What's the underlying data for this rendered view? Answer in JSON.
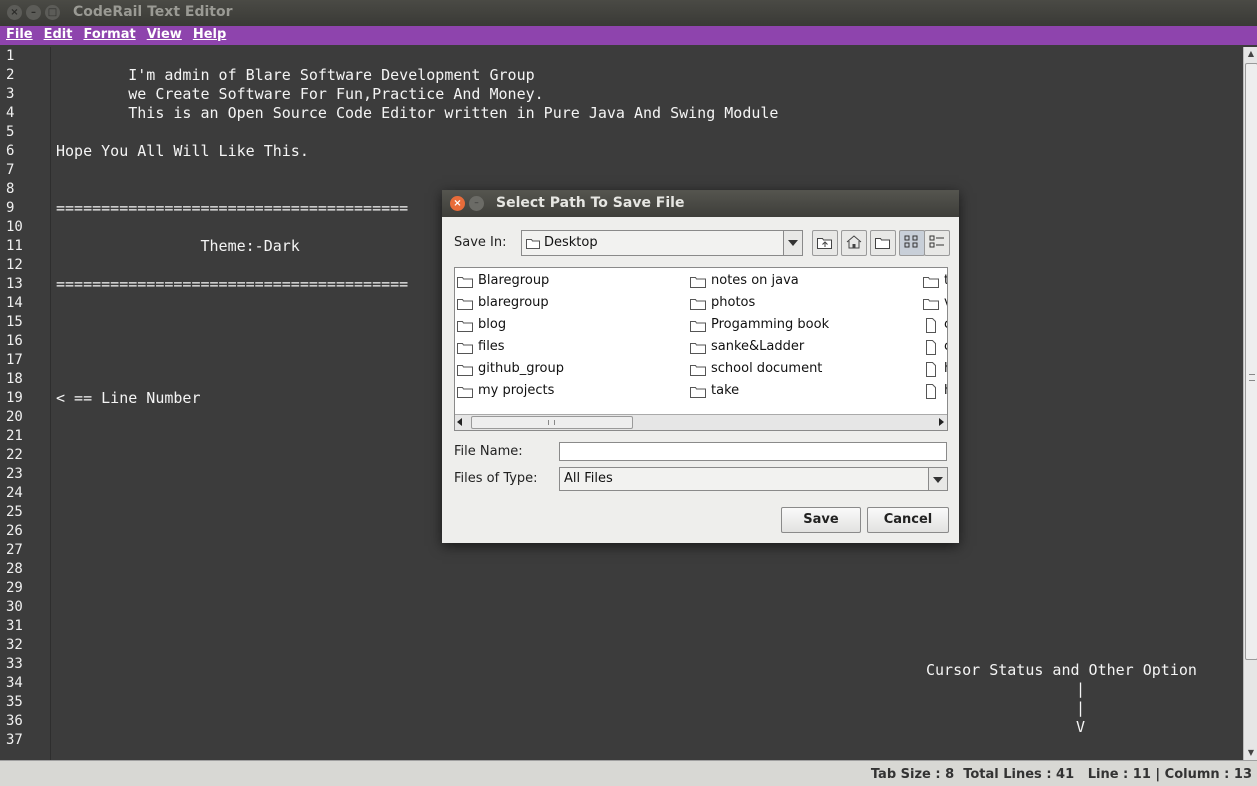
{
  "window": {
    "title": "CodeRail Text Editor"
  },
  "menu": {
    "items": [
      "File",
      "Edit",
      "Format",
      "View",
      "Help"
    ]
  },
  "editor": {
    "line_numbers": [
      "1",
      "2",
      "3",
      "4",
      "5",
      "6",
      "7",
      "8",
      "9",
      "10",
      "11",
      "12",
      "13",
      "14",
      "15",
      "16",
      "17",
      "18",
      "19",
      "20",
      "21",
      "22",
      "23",
      "24",
      "25",
      "26",
      "27",
      "28",
      "29",
      "30",
      "31",
      "32",
      "33",
      "34",
      "35",
      "36",
      "37"
    ],
    "lines": [
      "",
      "        I'm admin of Blare Software Development Group",
      "        we Create Software For Fun,Practice And Money.",
      "        This is an Open Source Code Editor written in Pure Java And Swing Module",
      "",
      "Hope You All Will Like This.",
      "",
      "",
      "=======================================",
      "",
      "                Theme:-Dark",
      "",
      "=======================================",
      "",
      "",
      "",
      "",
      "",
      "< == Line Number"
    ],
    "annotation_lines": [
      "Cursor Status and Other Option",
      "|",
      "|",
      "V"
    ]
  },
  "status": {
    "text": "Tab Size : 8  Total Lines : 41   Line : 11 | Column : 13"
  },
  "dialog": {
    "title": "Select Path To Save File",
    "save_in_label": "Save In:",
    "save_in_value": "Desktop",
    "file_name_label": "File Name:",
    "file_name_value": "",
    "files_of_type_label": "Files of Type:",
    "files_of_type_value": "All Files",
    "save_button": "Save",
    "cancel_button": "Cancel",
    "col1": [
      "Blaregroup",
      "blaregroup",
      "blog",
      "files",
      "github_group",
      "my projects"
    ],
    "col2": [
      "notes on java",
      "photos",
      "Progamming book",
      "sanke&Ladder",
      "school document",
      "take"
    ],
    "col3": [
      "t",
      "v",
      "c",
      "c",
      "h",
      "h"
    ]
  }
}
